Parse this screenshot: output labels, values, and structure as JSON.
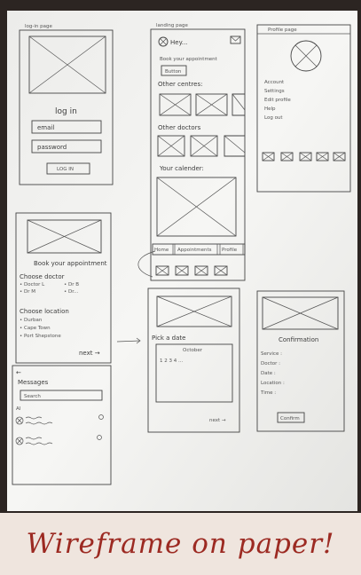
{
  "login": {
    "title": "log-in page",
    "heading": "log in",
    "email_placeholder": "email",
    "password_placeholder": "password",
    "login_button": "LOG IN"
  },
  "landing": {
    "title": "landing page",
    "greeting": "Hey...",
    "book_prompt": "Book your appointment",
    "button_label": "Button",
    "other_centers": "Other centres:",
    "other_doctors": "Other doctors",
    "calendar_label": "Your calender:",
    "tabs": [
      "Home",
      "Appointments",
      "Profile"
    ]
  },
  "profile": {
    "title": "Profile page",
    "menu": [
      "Account",
      "Settings",
      "Edit profile",
      "Help",
      "Log out"
    ]
  },
  "booking": {
    "title": "Book your appointment",
    "choose_doctor": "Choose doctor",
    "doctors": [
      "• Doctor L",
      "• Dr B",
      "• Dr M",
      "• Dr..."
    ],
    "choose_location": "Choose location",
    "locations": [
      "• Durban",
      "• Cape Town",
      "• Port Shepstone"
    ],
    "next": "next →"
  },
  "date": {
    "heading": "Pick a date",
    "month": "October",
    "days": "1  2  3  4 ...",
    "next": "next →"
  },
  "confirmation": {
    "heading": "Confirmation",
    "fields": [
      "Service :",
      "Doctor :",
      "Date :",
      "Location :",
      "Time :"
    ],
    "confirm_button": "Confirm"
  },
  "messages": {
    "back": "←",
    "heading": "Messages",
    "search_placeholder": "Search",
    "section": "AI"
  },
  "caption": "Wireframe on paper!",
  "colors": {
    "caption": "#9c2a22",
    "paper": "#f3f3f0",
    "background": "#efe5de"
  }
}
